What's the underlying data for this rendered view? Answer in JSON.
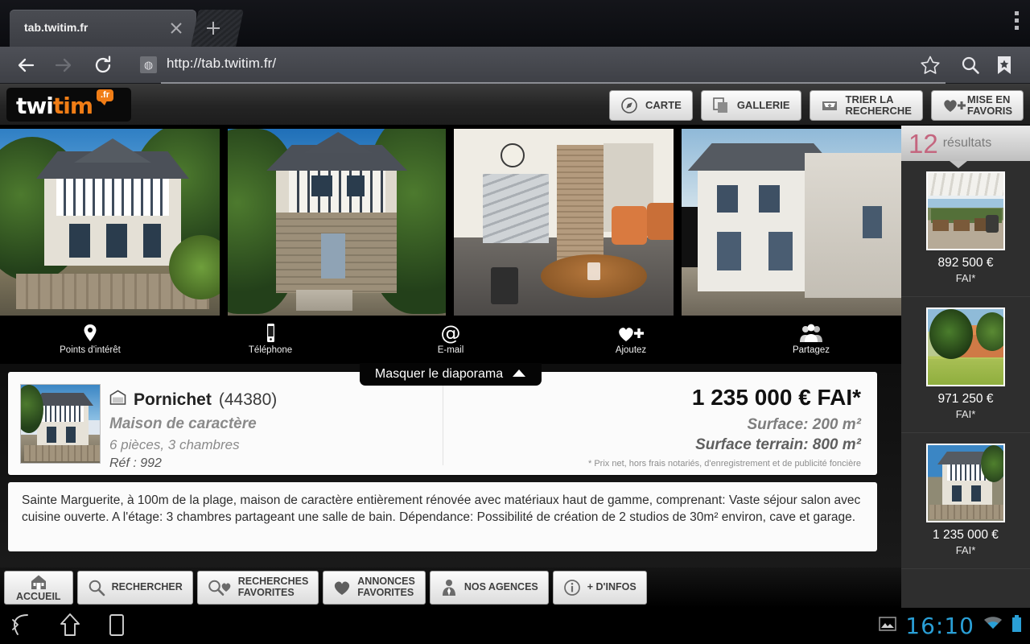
{
  "browser": {
    "tab_title": "tab.twitim.fr",
    "url": "http://tab.twitim.fr/",
    "close_icon": "close-icon",
    "new_tab_icon": "plus-icon",
    "back_icon": "back-arrow-icon",
    "forward_icon": "forward-arrow-icon",
    "reload_icon": "reload-icon",
    "favicon": "globe-icon",
    "star_icon": "star-icon",
    "search_icon": "search-icon",
    "bookmarks_icon": "bookmark-icon",
    "menu_icon": "overflow-menu-icon"
  },
  "site_header": {
    "logo": {
      "part1": "twi",
      "part2": "tim",
      "tld": ".fr",
      "accent": "#f07d16"
    },
    "buttons": [
      {
        "label": "CARTE",
        "label2": "",
        "icon": "compass-icon"
      },
      {
        "label": "GALLERIE",
        "label2": "",
        "icon": "gallery-icon"
      },
      {
        "label": "TRIER LA",
        "label2": "RECHERCHE",
        "icon": "tray-icon"
      },
      {
        "label": "MISE EN",
        "label2": "FAVORIS",
        "icon": "heart-plus-icon"
      }
    ]
  },
  "slideshow": {
    "action_items": [
      {
        "label": "Points d'intérêt",
        "icon": "map-pin-icon"
      },
      {
        "label": "Téléphone",
        "icon": "phone-icon"
      },
      {
        "label": "E-mail",
        "icon": "at-sign-icon"
      },
      {
        "label": "Ajoutez",
        "icon": "heart-plus-icon"
      },
      {
        "label": "Partagez",
        "icon": "people-icon"
      }
    ],
    "hide_label": "Masquer le diaporama",
    "hide_icon": "chevron-up-icon"
  },
  "listing": {
    "city": "Pornichet",
    "postal_code": "(44380)",
    "type": "Maison de caractère",
    "rooms": "6 pièces, 3 chambres",
    "reference": "Réf : 992",
    "price": "1 235 000 € FAI*",
    "surface": "Surface: 200 m²",
    "land_surface": "Surface terrain: 800 m²",
    "legal": "* Prix net, hors frais notariés, d'enregistrement et de publicité foncière",
    "description": "Sainte Marguerite, à 100m de la plage, maison de caractère entièrement rénovée avec matériaux haut de gamme, comprenant: Vaste séjour salon avec cuisine ouverte. A l'étage: 3 chambres partageant une salle de bain. Dépendance: Possibilité de création de 2 studios de 30m² environ, cave et garage.",
    "home_icon": "house-icon"
  },
  "bottom_toolbar": [
    {
      "label": "ACCUEIL",
      "label2": "",
      "icon": "home-icon"
    },
    {
      "label": "RECHERCHER",
      "label2": "",
      "icon": "magnifier-icon"
    },
    {
      "label": "RECHERCHES",
      "label2": "FAVORITES",
      "icon": "magnifier-heart-icon"
    },
    {
      "label": "ANNONCES",
      "label2": "FAVORITES",
      "icon": "heart-icon"
    },
    {
      "label": "NOS AGENCES",
      "label2": "",
      "icon": "person-tie-icon"
    },
    {
      "label": "+ D'INFOS",
      "label2": "",
      "icon": "info-icon"
    }
  ],
  "sidebar": {
    "count": "12",
    "count_label": "résultats",
    "count_color": "#c4667f",
    "results": [
      {
        "price": "892 500 €",
        "fai": "FAI*",
        "thumb": "terrace-photo"
      },
      {
        "price": "971 250 €",
        "fai": "FAI*",
        "thumb": "house-garden-photo"
      },
      {
        "price": "1 235 000 €",
        "fai": "FAI*",
        "thumb": "villa-photo"
      }
    ]
  },
  "android_nav": {
    "back_icon": "android-back-icon",
    "home_icon": "android-home-icon",
    "recents_icon": "android-recents-icon",
    "screenshot_icon": "screenshot-icon",
    "time": "16:10",
    "wifi_icon": "wifi-icon",
    "battery_icon": "battery-icon"
  }
}
